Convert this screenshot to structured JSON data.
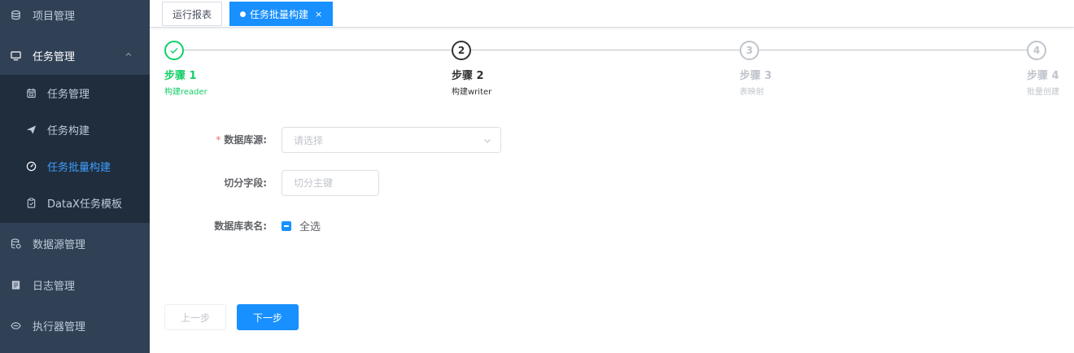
{
  "sidebar": {
    "items": [
      {
        "label": "项目管理",
        "icon": "database-icon"
      },
      {
        "label": "任务管理",
        "icon": "monitor-icon"
      },
      {
        "label": "数据源管理",
        "icon": "database-stack-icon"
      },
      {
        "label": "日志管理",
        "icon": "document-icon"
      },
      {
        "label": "执行器管理",
        "icon": "executor-icon"
      }
    ],
    "submenu": [
      {
        "label": "任务管理",
        "icon": "calendar-icon"
      },
      {
        "label": "任务构建",
        "icon": "paper-plane-icon"
      },
      {
        "label": "任务批量构建",
        "icon": "dashboard-icon"
      },
      {
        "label": "DataX任务模板",
        "icon": "clipboard-icon"
      }
    ]
  },
  "tabs": [
    {
      "label": "运行报表"
    },
    {
      "label": "任务批量构建",
      "close": "×"
    }
  ],
  "steps": [
    {
      "number": "1",
      "title": "步骤 1",
      "desc": "构建reader",
      "status": "done"
    },
    {
      "number": "2",
      "title": "步骤 2",
      "desc": "构建writer",
      "status": "process"
    },
    {
      "number": "3",
      "title": "步骤 3",
      "desc": "表映射",
      "status": "wait"
    },
    {
      "number": "4",
      "title": "步骤 4",
      "desc": "批量创建",
      "status": "wait"
    }
  ],
  "form": {
    "datasource_label": "数据库源:",
    "datasource_required": "*",
    "datasource_placeholder": "请选择",
    "split_label": "切分字段:",
    "split_placeholder": "切分主键",
    "tables_label": "数据库表名:",
    "select_all_label": "全选"
  },
  "buttons": {
    "prev": "上一步",
    "next": "下一步"
  },
  "colors": {
    "sidebar_bg": "#304156",
    "submenu_bg": "#1f2d3d",
    "accent": "#1890ff",
    "success": "#13ce66",
    "required": "#f56c6c"
  }
}
